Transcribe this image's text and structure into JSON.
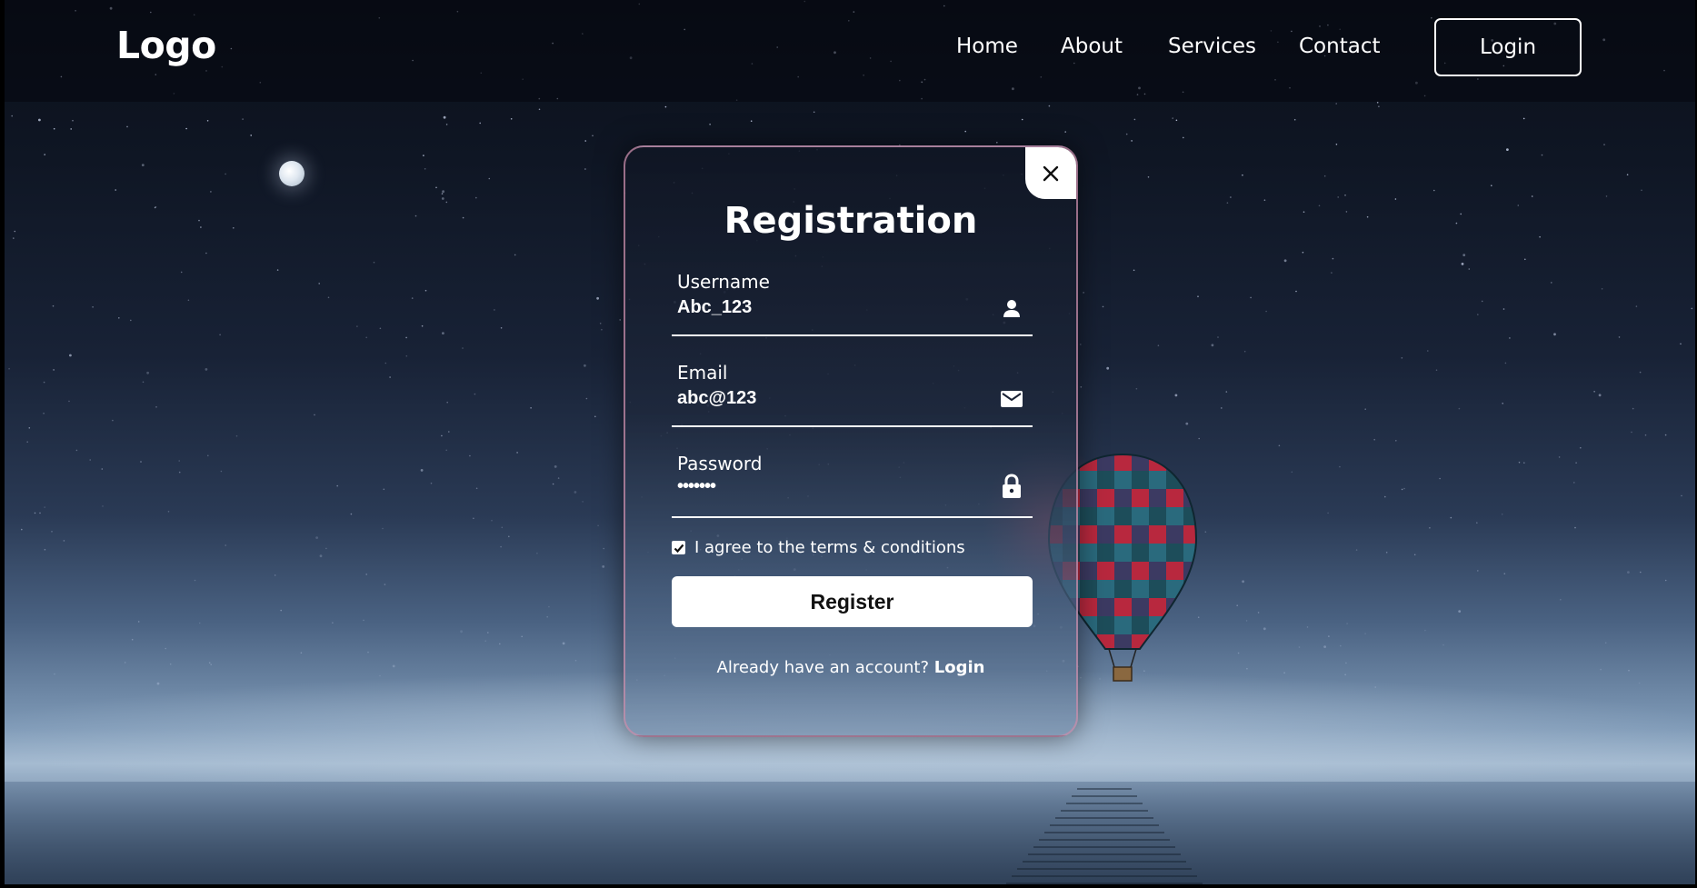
{
  "header": {
    "logo": "Logo",
    "nav": [
      "Home",
      "About",
      "Services",
      "Contact"
    ],
    "login_label": "Login"
  },
  "modal": {
    "title": "Registration",
    "fields": [
      {
        "label": "Username",
        "value": "Abc_123",
        "icon": "person-icon"
      },
      {
        "label": "Email",
        "value": "abc@123",
        "icon": "mail-icon"
      },
      {
        "label": "Password",
        "value": "•••••••",
        "icon": "lock-icon"
      }
    ],
    "agree_label": "I agree to the terms & conditions",
    "agree_checked": true,
    "register_label": "Register",
    "already_text": "Already have an account?",
    "already_login": "Login"
  },
  "colors": {
    "accent_text": "#ffffff",
    "modal_border": "#c88caa",
    "button_bg": "#ffffff"
  }
}
